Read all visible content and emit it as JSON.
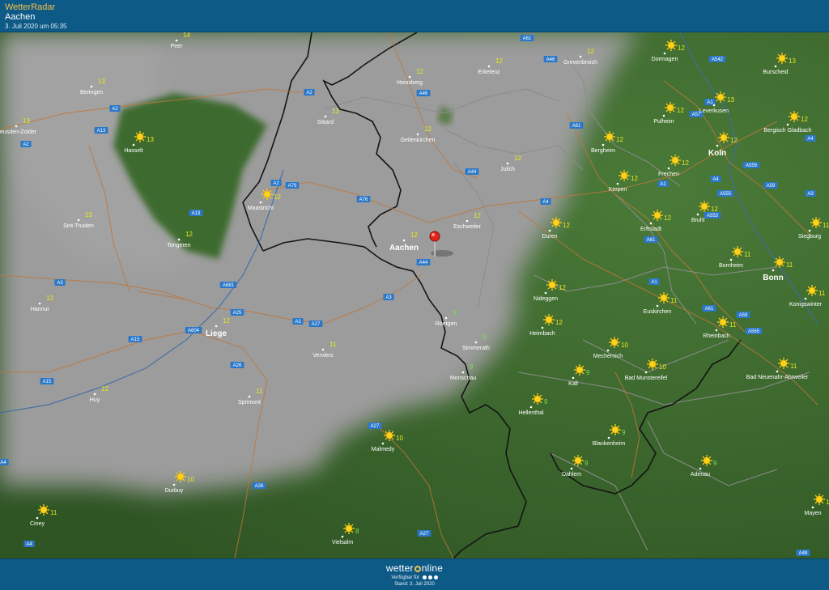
{
  "header": {
    "app_title": "WetterRadar",
    "location": "Aachen",
    "timestamp": "3. Juli 2020 um 05:35"
  },
  "footer": {
    "brand_prefix": "wetter",
    "brand_suffix": "nline",
    "available_label": "Verfügbar für",
    "stand": "Stand: 3. Juli 2020"
  },
  "colors": {
    "header_bg": "#0e5a87",
    "app_title": "#f3c14a",
    "terrain_green": "#3d6a2e",
    "cloud_grey": "#9c9c9c",
    "temp_yellow": "#e8e81e",
    "temp_green": "#7ee04a",
    "road_sign": "#2b78c9",
    "marker": "#e0241b"
  },
  "marker": {
    "icon": "map-pin-icon",
    "place": "Aachen"
  },
  "cities": [
    {
      "name": "Peer",
      "temp": "14",
      "sun": false
    },
    {
      "name": "Beringen",
      "temp": "13",
      "sun": false
    },
    {
      "name": "Heusden-Zolder",
      "temp": "13",
      "sun": false
    },
    {
      "name": "Hasselt",
      "temp": "13",
      "sun": true
    },
    {
      "name": "Maastricht",
      "temp": "12",
      "sun": true
    },
    {
      "name": "Sint-Truiden",
      "temp": "13",
      "sun": false
    },
    {
      "name": "Tongeren",
      "temp": "12",
      "sun": false
    },
    {
      "name": "Hannut",
      "temp": "12",
      "sun": false
    },
    {
      "name": "Liege",
      "temp": "12",
      "sun": false
    },
    {
      "name": "Huy",
      "temp": "12",
      "sun": false
    },
    {
      "name": "Sprimont",
      "temp": "11",
      "sun": false
    },
    {
      "name": "Verviers",
      "temp": "11",
      "sun": false
    },
    {
      "name": "Sittard",
      "temp": "13",
      "sun": false
    },
    {
      "name": "Heinsberg",
      "temp": "12",
      "sun": false
    },
    {
      "name": "Geilenkirchen",
      "temp": "12",
      "sun": false
    },
    {
      "name": "Erkelenz",
      "temp": "12",
      "sun": false
    },
    {
      "name": "Grevenbroich",
      "temp": "12",
      "sun": false
    },
    {
      "name": "Julich",
      "temp": "12",
      "sun": false
    },
    {
      "name": "Aachen",
      "temp": "12",
      "sun": false
    },
    {
      "name": "Eschweiler",
      "temp": "12",
      "sun": false
    },
    {
      "name": "Roetgen",
      "temp": "9",
      "sun": false
    },
    {
      "name": "Simmerath",
      "temp": "9",
      "sun": false
    },
    {
      "name": "Monschau",
      "temp": "9",
      "sun": false
    },
    {
      "name": "Dormagen",
      "temp": "12",
      "sun": true
    },
    {
      "name": "Burscheid",
      "temp": "13",
      "sun": true
    },
    {
      "name": "Leverkusen",
      "temp": "13",
      "sun": true
    },
    {
      "name": "Pulheim",
      "temp": "12",
      "sun": true
    },
    {
      "name": "Bergisch Gladbach",
      "temp": "12",
      "sun": true
    },
    {
      "name": "Koln",
      "temp": "12",
      "sun": true
    },
    {
      "name": "Bergheim",
      "temp": "12",
      "sun": true
    },
    {
      "name": "Frechen",
      "temp": "12",
      "sun": true
    },
    {
      "name": "Kerpen",
      "temp": "12",
      "sun": true
    },
    {
      "name": "Bruhl",
      "temp": "12",
      "sun": true
    },
    {
      "name": "Erftstadt",
      "temp": "12",
      "sun": true
    },
    {
      "name": "Duren",
      "temp": "12",
      "sun": true
    },
    {
      "name": "Siegburg",
      "temp": "11",
      "sun": true
    },
    {
      "name": "Bornheim",
      "temp": "11",
      "sun": true
    },
    {
      "name": "Bonn",
      "temp": "11",
      "sun": true
    },
    {
      "name": "Konigswinter",
      "temp": "11",
      "sun": true
    },
    {
      "name": "Nideggen",
      "temp": "12",
      "sun": true
    },
    {
      "name": "Euskirchen",
      "temp": "11",
      "sun": true
    },
    {
      "name": "Heimbach",
      "temp": "12",
      "sun": true
    },
    {
      "name": "Rheinbach",
      "temp": "11",
      "sun": true
    },
    {
      "name": "Mechernich",
      "temp": "10",
      "sun": true
    },
    {
      "name": "Kall",
      "temp": "9",
      "sun": true
    },
    {
      "name": "Bad Munstereifel",
      "temp": "10",
      "sun": true
    },
    {
      "name": "Bad Neuenahr-Ahrweiler",
      "temp": "11",
      "sun": true
    },
    {
      "name": "Hellenthal",
      "temp": "9",
      "sun": true
    },
    {
      "name": "Blankenheim",
      "temp": "9",
      "sun": true
    },
    {
      "name": "Dahlem",
      "temp": "9",
      "sun": true
    },
    {
      "name": "Adenau",
      "temp": "9",
      "sun": true
    },
    {
      "name": "Mayen",
      "temp": "11",
      "sun": true
    },
    {
      "name": "Malmedy",
      "temp": "10",
      "sun": true
    },
    {
      "name": "Durbuy",
      "temp": "10",
      "sun": true
    },
    {
      "name": "Ciney",
      "temp": "11",
      "sun": true
    },
    {
      "name": "Vielsalm",
      "temp": "8",
      "sun": true
    }
  ],
  "roads": [
    "A2",
    "A2",
    "A13",
    "A2",
    "A13",
    "A79",
    "A2",
    "A76",
    "A46",
    "A61",
    "A46",
    "A61",
    "A57",
    "A542",
    "A1",
    "A4",
    "A559",
    "A4",
    "A555",
    "A59",
    "A3",
    "A553",
    "A59",
    "A61",
    "A44",
    "A4",
    "A44",
    "A3",
    "A681",
    "A3",
    "A25",
    "A3",
    "A27",
    "A604",
    "A15",
    "A26",
    "A15",
    "A27",
    "A26",
    "A1",
    "A61",
    "A565",
    "A1",
    "A27",
    "A4",
    "A4",
    "A48"
  ]
}
